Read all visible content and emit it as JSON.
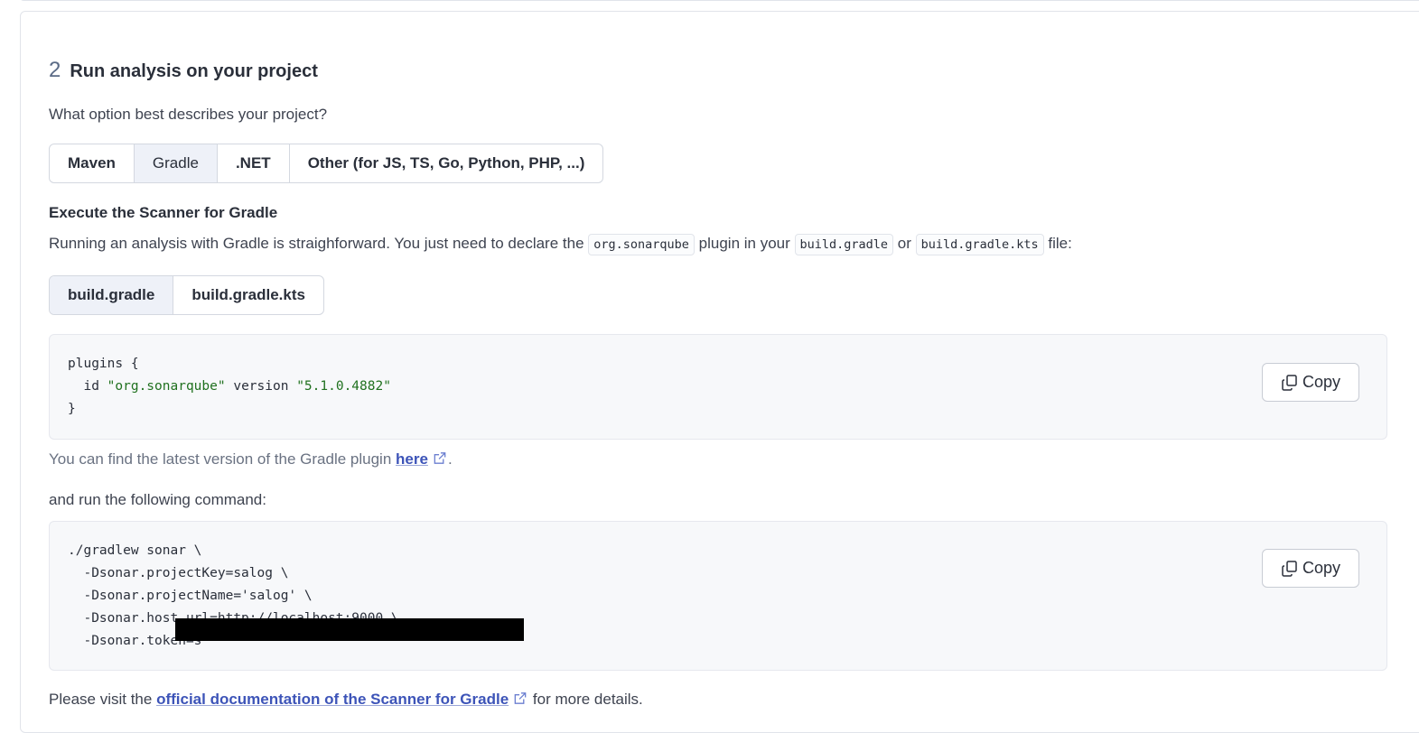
{
  "step": {
    "number": "2",
    "title": "Run analysis on your project",
    "question": "What option best describes your project?"
  },
  "build_options": [
    "Maven",
    "Gradle",
    ".NET",
    "Other (for JS, TS, Go, Python, PHP, ...)"
  ],
  "build_selected": "Gradle",
  "scanner": {
    "heading": "Execute the Scanner for Gradle",
    "desc_before": "Running an analysis with Gradle is straighforward. You just need to declare the ",
    "code_plugin": "org.sonarqube",
    "desc_mid1": " plugin in your ",
    "code_file1": "build.gradle",
    "desc_mid2": " or ",
    "code_file2": "build.gradle.kts",
    "desc_after": " file:"
  },
  "file_options": [
    "build.gradle",
    "build.gradle.kts"
  ],
  "file_selected": "build.gradle",
  "plugin_code": {
    "line1": "plugins {",
    "line2_prefix": "  id ",
    "line2_id": "\"org.sonarqube\"",
    "line2_mid": " version ",
    "line2_version": "\"5.1.0.4882\"",
    "line3": "}"
  },
  "copy_label": "Copy",
  "version_note": {
    "before": "You can find the latest version of the Gradle plugin ",
    "link": "here",
    "after": "."
  },
  "run_text": "and run the following command:",
  "command_lines": [
    "./gradlew sonar \\",
    "  -Dsonar.projectKey=salog \\",
    "  -Dsonar.projectName='salog' \\",
    "  -Dsonar.host.url=http://localhost:9000 \\",
    "  -Dsonar.token=s"
  ],
  "footer": {
    "before": "Please visit the ",
    "link": "official documentation of the Scanner for Gradle",
    "after": " for more details."
  },
  "icons": {
    "copy": "copy-icon",
    "external": "external-link-icon"
  },
  "colors": {
    "link": "#3d54b8",
    "string": "#20711f",
    "selected_bg": "#eef1f8"
  }
}
